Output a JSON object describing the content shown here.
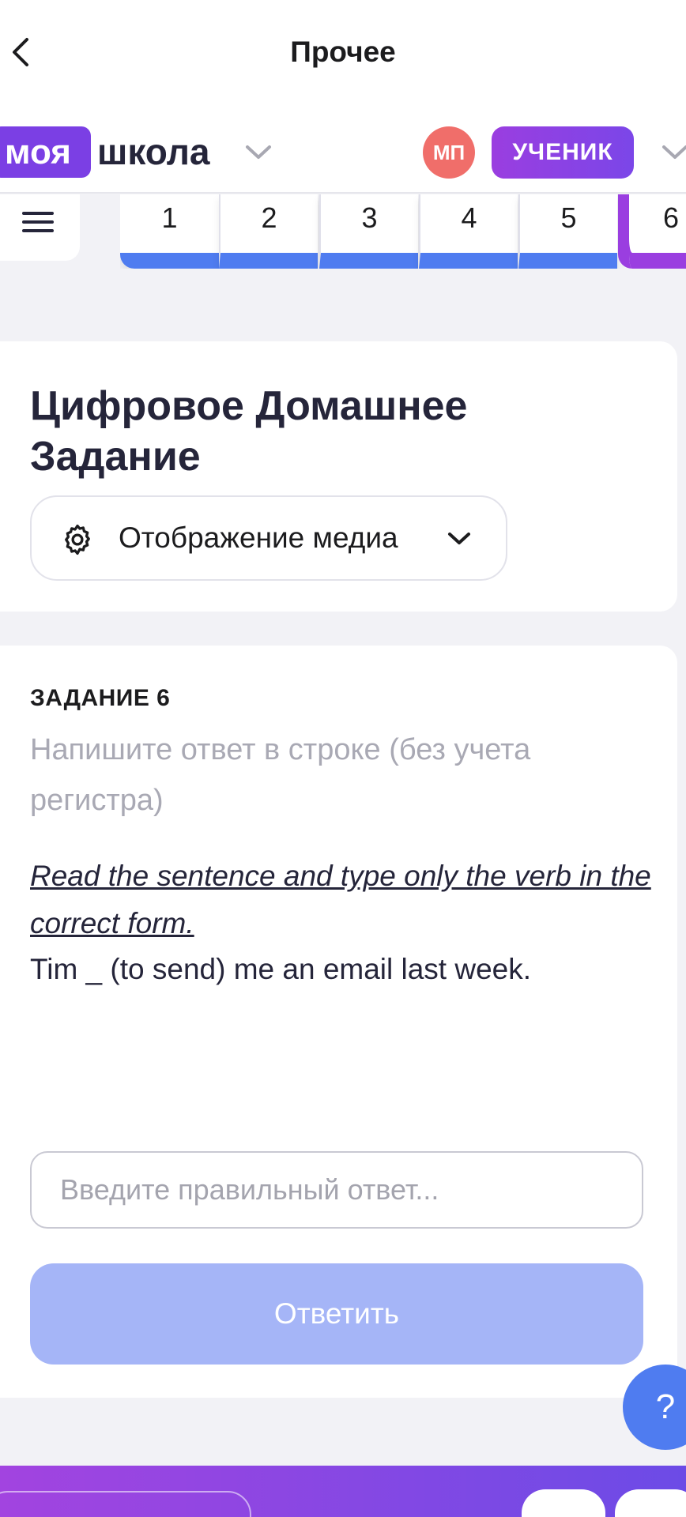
{
  "topbar": {
    "title": "Прочее"
  },
  "brand": {
    "logo_part1": "моя",
    "logo_part2": "школа",
    "avatar_initials": "МП",
    "role": "УЧЕНИК"
  },
  "tasks_nav": {
    "tabs": [
      "1",
      "2",
      "3",
      "4",
      "5",
      "6"
    ],
    "active": "6"
  },
  "homework": {
    "title": "Цифровое Домашнее Задание",
    "media_display_label": "Отображение медиа"
  },
  "task": {
    "label": "ЗАДАНИЕ 6",
    "hint": "Напишите ответ в строке (без учета регистра)",
    "instruction": "Read the sentence and type only the verb in the correct form.",
    "sentence": "Tim _ (to send) me an email last week.",
    "answer_placeholder": "Введите правильный ответ...",
    "submit_label": "Ответить"
  },
  "help": {
    "label": "?"
  },
  "colors": {
    "brand_purple": "#7b3fe4",
    "accent_blue": "#4f7cf0",
    "avatar_red": "#f06e6a",
    "button_disabled": "#a5b5f7"
  }
}
